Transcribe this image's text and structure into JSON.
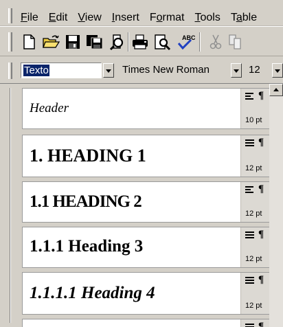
{
  "menu": {
    "items": [
      {
        "label": "File",
        "accel": "F",
        "rest": "ile"
      },
      {
        "label": "Edit",
        "accel": "E",
        "rest": "dit"
      },
      {
        "label": "View",
        "accel": "V",
        "rest": "iew"
      },
      {
        "label": "Insert",
        "accel": "I",
        "rest": "nsert"
      },
      {
        "label": "Format",
        "pre": "F",
        "accel": "o",
        "rest": "rmat"
      },
      {
        "label": "Tools",
        "accel": "T",
        "rest": "ools"
      },
      {
        "label": "Table",
        "pre": "T",
        "accel": "a",
        "rest": "ble"
      }
    ]
  },
  "toolbar": {
    "buttons": [
      "new-icon",
      "open-icon",
      "save-icon",
      "save-all-icon",
      "print-preview-icon",
      "print-icon",
      "preview-icon",
      "spelling-icon",
      "cut-icon",
      "copy-icon"
    ]
  },
  "formatting": {
    "style_value": "Texto",
    "font_value": "Times New Roman",
    "size_value": "12"
  },
  "styles": [
    {
      "text": "Header",
      "size": "10 pt",
      "alignment": "left"
    },
    {
      "text": "1.  HEADING 1",
      "size": "12 pt",
      "alignment": "justify"
    },
    {
      "text": "1.1  HEADING 2",
      "display_small_caps": true,
      "size": "12 pt",
      "alignment": "left"
    },
    {
      "text": "1.1.1  Heading 3",
      "size": "12 pt",
      "alignment": "justify"
    },
    {
      "text": "1.1.1.1  Heading 4",
      "size": "12 pt",
      "alignment": "justify"
    }
  ],
  "colors": {
    "chrome": "#d4d0c8",
    "selection": "#0a246a"
  }
}
